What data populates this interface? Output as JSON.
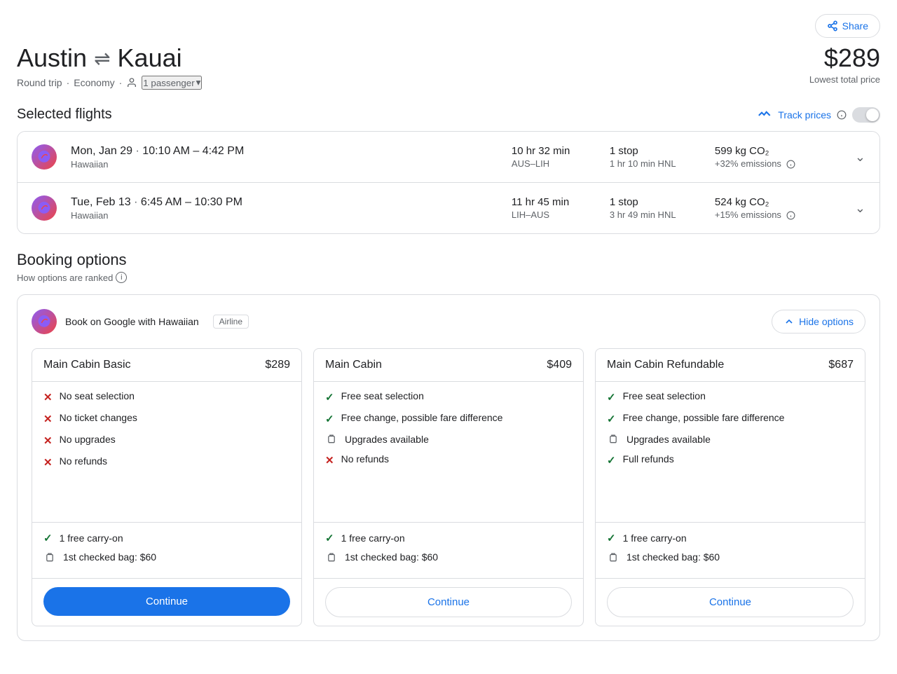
{
  "header": {
    "origin": "Austin",
    "destination": "Kauai",
    "arrow": "⇌",
    "price": "$289",
    "price_label": "Lowest total price",
    "share_label": "Share",
    "trip_type": "Round trip",
    "cabin": "Economy",
    "passengers": "1 passenger"
  },
  "track_prices": {
    "label": "Track prices",
    "toggle_state": false
  },
  "selected_flights": {
    "title": "Selected flights",
    "flights": [
      {
        "date": "Mon, Jan 29",
        "time_range": "10:10 AM – 4:42 PM",
        "airline": "Hawaiian",
        "duration": "10 hr 32 min",
        "route": "AUS–LIH",
        "stops": "1 stop",
        "stop_detail": "1 hr 10 min HNL",
        "emissions": "599 kg CO₂",
        "emissions_detail": "+32% emissions"
      },
      {
        "date": "Tue, Feb 13",
        "time_range": "6:45 AM – 10:30 PM",
        "airline": "Hawaiian",
        "duration": "11 hr 45 min",
        "route": "LIH–AUS",
        "stops": "1 stop",
        "stop_detail": "3 hr 49 min HNL",
        "emissions": "524 kg CO₂",
        "emissions_detail": "+15% emissions"
      }
    ]
  },
  "booking_options": {
    "title": "Booking options",
    "ranking_label": "How options are ranked",
    "provider": "Book on Google with Hawaiian",
    "provider_badge": "Airline",
    "hide_label": "Hide options",
    "fares": [
      {
        "name": "Main Cabin Basic",
        "price": "$289",
        "features": [
          {
            "type": "cross",
            "text": "No seat selection"
          },
          {
            "type": "cross",
            "text": "No ticket changes"
          },
          {
            "type": "cross",
            "text": "No upgrades"
          },
          {
            "type": "cross",
            "text": "No refunds"
          }
        ],
        "bags": [
          {
            "type": "check",
            "text": "1 free carry-on"
          },
          {
            "type": "luggage",
            "text": "1st checked bag: $60"
          }
        ],
        "cta": "Continue",
        "cta_style": "primary"
      },
      {
        "name": "Main Cabin",
        "price": "$409",
        "features": [
          {
            "type": "check",
            "text": "Free seat selection"
          },
          {
            "type": "check",
            "text": "Free change, possible fare difference"
          },
          {
            "type": "luggage",
            "text": "Upgrades available"
          },
          {
            "type": "cross",
            "text": "No refunds"
          }
        ],
        "bags": [
          {
            "type": "check",
            "text": "1 free carry-on"
          },
          {
            "type": "luggage",
            "text": "1st checked bag: $60"
          }
        ],
        "cta": "Continue",
        "cta_style": "secondary"
      },
      {
        "name": "Main Cabin Refundable",
        "price": "$687",
        "features": [
          {
            "type": "check",
            "text": "Free seat selection"
          },
          {
            "type": "check",
            "text": "Free change, possible fare difference"
          },
          {
            "type": "luggage",
            "text": "Upgrades available"
          },
          {
            "type": "check",
            "text": "Full refunds"
          }
        ],
        "bags": [
          {
            "type": "check",
            "text": "1 free carry-on"
          },
          {
            "type": "luggage",
            "text": "1st checked bag: $60"
          }
        ],
        "cta": "Continue",
        "cta_style": "secondary"
      }
    ]
  }
}
